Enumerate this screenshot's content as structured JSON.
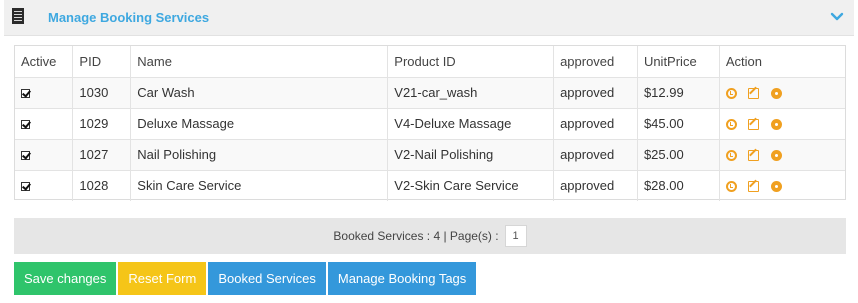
{
  "header": {
    "title": "Manage Booking Services",
    "icon": "document-list-icon",
    "collapse_icon": "chevron-down-icon",
    "accent_color": "#3ea8e0"
  },
  "table": {
    "columns": [
      "Active",
      "PID",
      "Name",
      "Product ID",
      "approved",
      "UnitPrice",
      "Action"
    ],
    "rows": [
      {
        "active": true,
        "pid": "1030",
        "name": "Car Wash",
        "product_id": "V21-car_wash",
        "status": "approved",
        "unit_price": "$12.99"
      },
      {
        "active": true,
        "pid": "1029",
        "name": "Deluxe Massage",
        "product_id": "V4-Deluxe Massage",
        "status": "approved",
        "unit_price": "$45.00"
      },
      {
        "active": true,
        "pid": "1027",
        "name": "Nail Polishing",
        "product_id": "V2-Nail Polishing",
        "status": "approved",
        "unit_price": "$25.00"
      },
      {
        "active": true,
        "pid": "1028",
        "name": "Skin Care Service",
        "product_id": "V2-Skin Care Service",
        "status": "approved",
        "unit_price": "$28.00"
      }
    ],
    "action_icons": [
      "clock-icon",
      "edit-icon",
      "gear-icon"
    ],
    "action_color": "#f0a020"
  },
  "footer": {
    "summary": "Booked Services : 4 | Page(s) :",
    "current_page": "1"
  },
  "buttons": {
    "save": "Save changes",
    "reset": "Reset Form",
    "booked": "Booked Services",
    "tags": "Manage Booking Tags",
    "colors": {
      "save": "#2fc46b",
      "reset": "#f5c518",
      "booked": "#3498db",
      "tags": "#3498db"
    }
  }
}
